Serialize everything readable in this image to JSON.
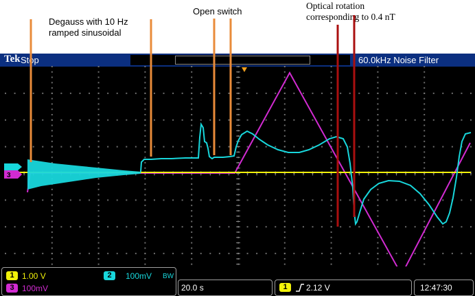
{
  "annotations": {
    "degauss": [
      "Degauss with 10 Hz",
      "ramped sinusoidal"
    ],
    "open_switch": "Open switch",
    "optical": [
      "Optical rotation",
      "corresponding to 0.4 nT"
    ]
  },
  "scope": {
    "brand": "Tek",
    "status": "Stop",
    "filter": "60.0kHz  Noise Filter",
    "ground_marker": "3"
  },
  "channels": {
    "ch1": {
      "id": "1",
      "scale": "1.00 V",
      "color": "#f2f20a"
    },
    "ch2": {
      "id": "2",
      "scale": "100mV",
      "bw": "BW",
      "color": "#18d7dc"
    },
    "ch3": {
      "id": "3",
      "scale": "100mV",
      "color": "#d22bd2"
    }
  },
  "timebase": "20.0 s",
  "trigger": {
    "channel": "1",
    "level": "2.12 V"
  },
  "clock": "12:47:30",
  "colors": {
    "trace_yellow": "#f2f20a",
    "trace_cyan": "#18d7dc",
    "trace_magenta": "#d22bd2",
    "marker_orange": "#e98b3a",
    "marker_darkred": "#aa0f0f",
    "header_blue": "#0b2f80"
  }
}
